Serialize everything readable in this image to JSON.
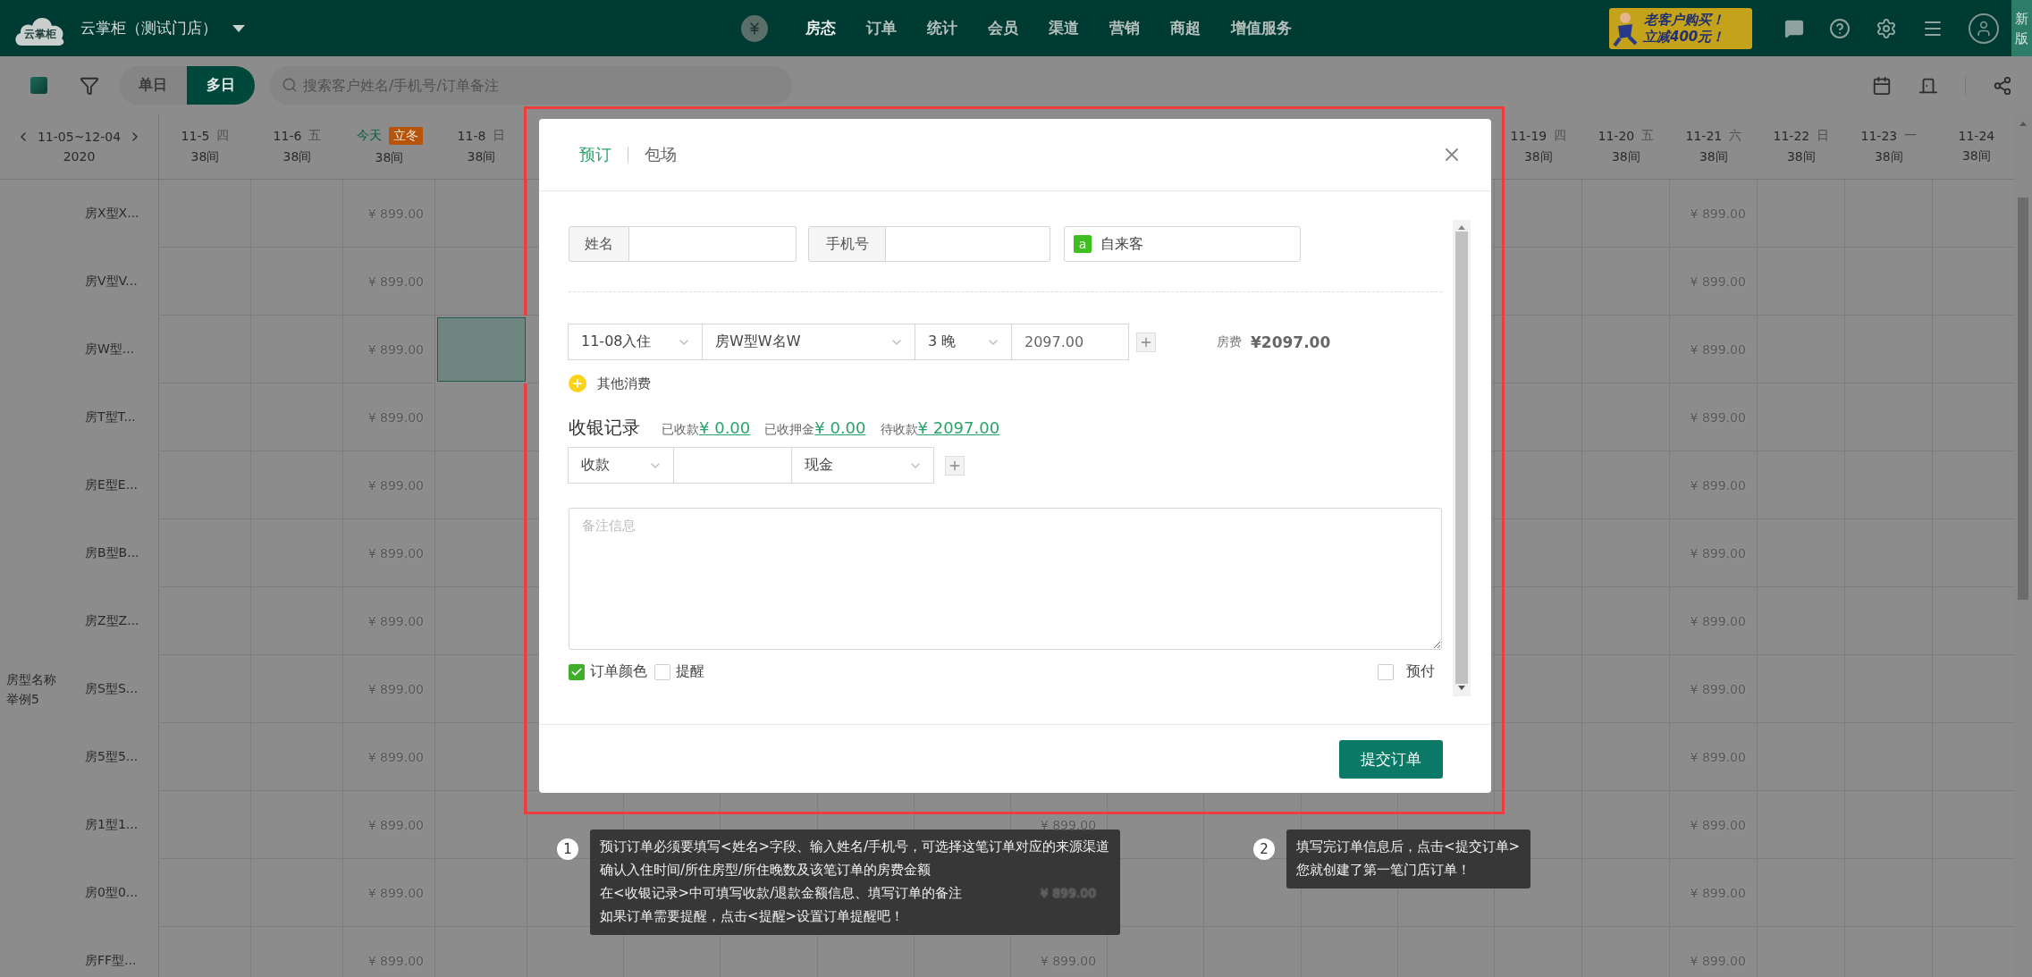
{
  "top_bar": {
    "logo_text": "云掌柜",
    "store": "云掌柜（测试门店）",
    "nav": [
      {
        "label": "房态",
        "selected": true
      },
      {
        "label": "订单",
        "selected": false
      },
      {
        "label": "统计",
        "selected": false
      },
      {
        "label": "会员",
        "selected": false
      },
      {
        "label": "渠道",
        "selected": false
      },
      {
        "label": "营销",
        "selected": false
      },
      {
        "label": "商超",
        "selected": false
      },
      {
        "label": "增值服务",
        "selected": false
      }
    ],
    "promo": {
      "line1": "老客户购买！",
      "line2": "立减400元！"
    },
    "new_version": "新版"
  },
  "toolbar": {
    "view_modes": [
      {
        "label": "单日",
        "selected": false
      },
      {
        "label": "多日",
        "selected": true
      }
    ],
    "search": {
      "placeholder": "搜索客户姓名/手机号/订单备注"
    }
  },
  "calendar": {
    "range": "11-05~12-04",
    "year": "2020",
    "group_label": "房型名称举例5",
    "dates_left": [
      {
        "date": "11-5",
        "weekday": "四",
        "rooms": "38间",
        "today": false
      },
      {
        "date": "11-6",
        "weekday": "五",
        "rooms": "38间",
        "today": false
      },
      {
        "date": "今天",
        "badge": "立冬",
        "rooms": "38间",
        "today": true
      },
      {
        "date": "11-8",
        "weekday": "日",
        "rooms": "38间",
        "today": false
      }
    ],
    "dates_right": [
      {
        "date": "11-19",
        "weekday": "四",
        "rooms": "38间",
        "today": false
      },
      {
        "date": "11-20",
        "weekday": "五",
        "rooms": "38间",
        "today": false
      },
      {
        "date": "11-21",
        "weekday": "六",
        "rooms": "38间",
        "today": false
      },
      {
        "date": "11-22",
        "weekday": "日",
        "rooms": "38间",
        "today": false
      },
      {
        "date": "11-23",
        "weekday": "一",
        "rooms": "38间",
        "today": false
      },
      {
        "date": "11-24",
        "rooms": "38间",
        "today": false
      }
    ],
    "rows": [
      {
        "name": "房X型X...",
        "cells": [
          null,
          null,
          {
            "text": "¥ 899.00",
            "selected": false
          },
          null,
          null,
          null,
          null,
          null,
          null,
          null,
          null,
          null,
          null,
          null,
          null,
          null,
          {
            "text": "¥ 899.00",
            "selected": false
          },
          null,
          null,
          null
        ]
      },
      {
        "name": "房V型V...",
        "cells": [
          null,
          null,
          {
            "text": "¥ 899.00",
            "selected": false
          },
          null,
          null,
          null,
          null,
          null,
          null,
          null,
          null,
          null,
          null,
          null,
          null,
          null,
          {
            "text": "¥ 899.00",
            "selected": false
          },
          null,
          null,
          null
        ]
      },
      {
        "name": "房W型...",
        "cells": [
          null,
          null,
          {
            "text": "¥ 899.00",
            "selected": false
          },
          {
            "selected": true
          },
          null,
          null,
          null,
          null,
          null,
          null,
          null,
          null,
          null,
          null,
          null,
          null,
          {
            "text": "¥ 899.00",
            "selected": false
          },
          null,
          null,
          null
        ]
      },
      {
        "name": "房T型T...",
        "cells": [
          null,
          null,
          {
            "text": "¥ 899.00",
            "selected": false
          },
          null,
          null,
          null,
          null,
          null,
          null,
          null,
          null,
          null,
          null,
          null,
          null,
          null,
          {
            "text": "¥ 899.00",
            "selected": false
          },
          null,
          null,
          null
        ]
      },
      {
        "name": "房E型E...",
        "cells": [
          null,
          null,
          {
            "text": "¥ 899.00",
            "selected": false
          },
          null,
          null,
          null,
          null,
          null,
          null,
          null,
          null,
          null,
          null,
          null,
          null,
          null,
          {
            "text": "¥ 899.00",
            "selected": false
          },
          null,
          null,
          null
        ]
      },
      {
        "name": "房B型B...",
        "cells": [
          null,
          null,
          {
            "text": "¥ 899.00",
            "selected": false
          },
          null,
          null,
          null,
          null,
          null,
          null,
          null,
          null,
          null,
          null,
          null,
          null,
          null,
          {
            "text": "¥ 899.00",
            "selected": false
          },
          null,
          null,
          null
        ]
      },
      {
        "name": "房Z型Z...",
        "cells": [
          null,
          null,
          {
            "text": "¥ 899.00",
            "selected": false
          },
          null,
          null,
          null,
          null,
          null,
          null,
          null,
          null,
          null,
          null,
          null,
          null,
          null,
          {
            "text": "¥ 899.00",
            "selected": false
          },
          null,
          null,
          null
        ]
      },
      {
        "name": "房S型S...",
        "cells": [
          null,
          null,
          {
            "text": "¥ 899.00",
            "selected": false
          },
          null,
          null,
          null,
          null,
          null,
          null,
          null,
          null,
          null,
          null,
          null,
          null,
          null,
          {
            "text": "¥ 899.00",
            "selected": false
          },
          null,
          null,
          null
        ]
      },
      {
        "name": "房5型5...",
        "cells": [
          null,
          null,
          {
            "text": "¥ 899.00",
            "selected": false
          },
          null,
          null,
          null,
          null,
          null,
          null,
          null,
          null,
          null,
          null,
          null,
          null,
          null,
          {
            "text": "¥ 899.00",
            "selected": false
          },
          null,
          null,
          null
        ]
      },
      {
        "name": "房1型1...",
        "cells": [
          null,
          null,
          {
            "text": "¥ 899.00",
            "selected": false
          },
          null,
          null,
          null,
          null,
          null,
          null,
          {
            "text": "¥ 899.00",
            "selected": false
          },
          null,
          null,
          null,
          null,
          null,
          null,
          {
            "text": "¥ 899.00",
            "selected": false
          },
          null,
          null,
          null
        ]
      },
      {
        "name": "房0型0...",
        "cells": [
          null,
          null,
          {
            "text": "¥ 899.00",
            "selected": false
          },
          null,
          null,
          null,
          null,
          null,
          null,
          {
            "text": "¥ 899.00",
            "selected": false
          },
          null,
          null,
          null,
          null,
          null,
          null,
          {
            "text": "¥ 899.00",
            "selected": false
          },
          null,
          null,
          null
        ]
      },
      {
        "name": "房FF型...",
        "cells": [
          null,
          null,
          {
            "text": "¥ 899.00",
            "selected": false
          },
          null,
          null,
          null,
          null,
          null,
          null,
          {
            "text": "¥ 899.00",
            "selected": false
          },
          null,
          null,
          null,
          null,
          null,
          null,
          {
            "text": "¥ 899.00",
            "selected": false
          },
          null,
          null,
          null
        ]
      }
    ]
  },
  "modal": {
    "tabs": [
      {
        "label": "预订",
        "selected": true
      },
      {
        "label": "包场",
        "selected": false
      }
    ],
    "name_label": "姓名",
    "phone_label": "手机号",
    "source": {
      "badge": "a",
      "value": "自来客"
    },
    "stay": {
      "checkin": "11-08入住",
      "room_type": "房W型W名W",
      "nights": "3 晚",
      "price": "2097.00"
    },
    "room_fee": {
      "label": "房费",
      "value": "¥2097.00"
    },
    "other_charges": "其他消费",
    "cashier": {
      "title": "收银记录",
      "amounts": [
        {
          "label": "已收款",
          "value": "¥ 0.00"
        },
        {
          "label": "已收押金",
          "value": "¥ 0.00"
        },
        {
          "label": "待收款",
          "value": "¥ 2097.00"
        }
      ]
    },
    "payment": {
      "type": "收款",
      "method": "现金"
    },
    "remark": {
      "placeholder": "备注信息"
    },
    "options": [
      {
        "label": "订单颜色",
        "checked": true
      },
      {
        "label": "提醒",
        "checked": false
      }
    ],
    "prepay": {
      "label": "预付",
      "checked": false
    },
    "submit": "提交订单"
  },
  "guides": [
    {
      "number": "1",
      "lines": [
        "预订订单必须要填写<姓名>字段、输入姓名/手机号，可选择这笔订单对应的来源渠道",
        "确认入住时间/所住房型/所住晚数及该笔订单的房费金额",
        "在<收银记录>中可填写收款/退款金额信息、填写订单的备注",
        "如果订单需要提醒，点击<提醒>设置订单提醒吧！"
      ]
    },
    {
      "number": "2",
      "lines": [
        "填写完订单信息后，点击<提交订单>",
        "您就创建了第一笔门店订单！"
      ]
    }
  ]
}
